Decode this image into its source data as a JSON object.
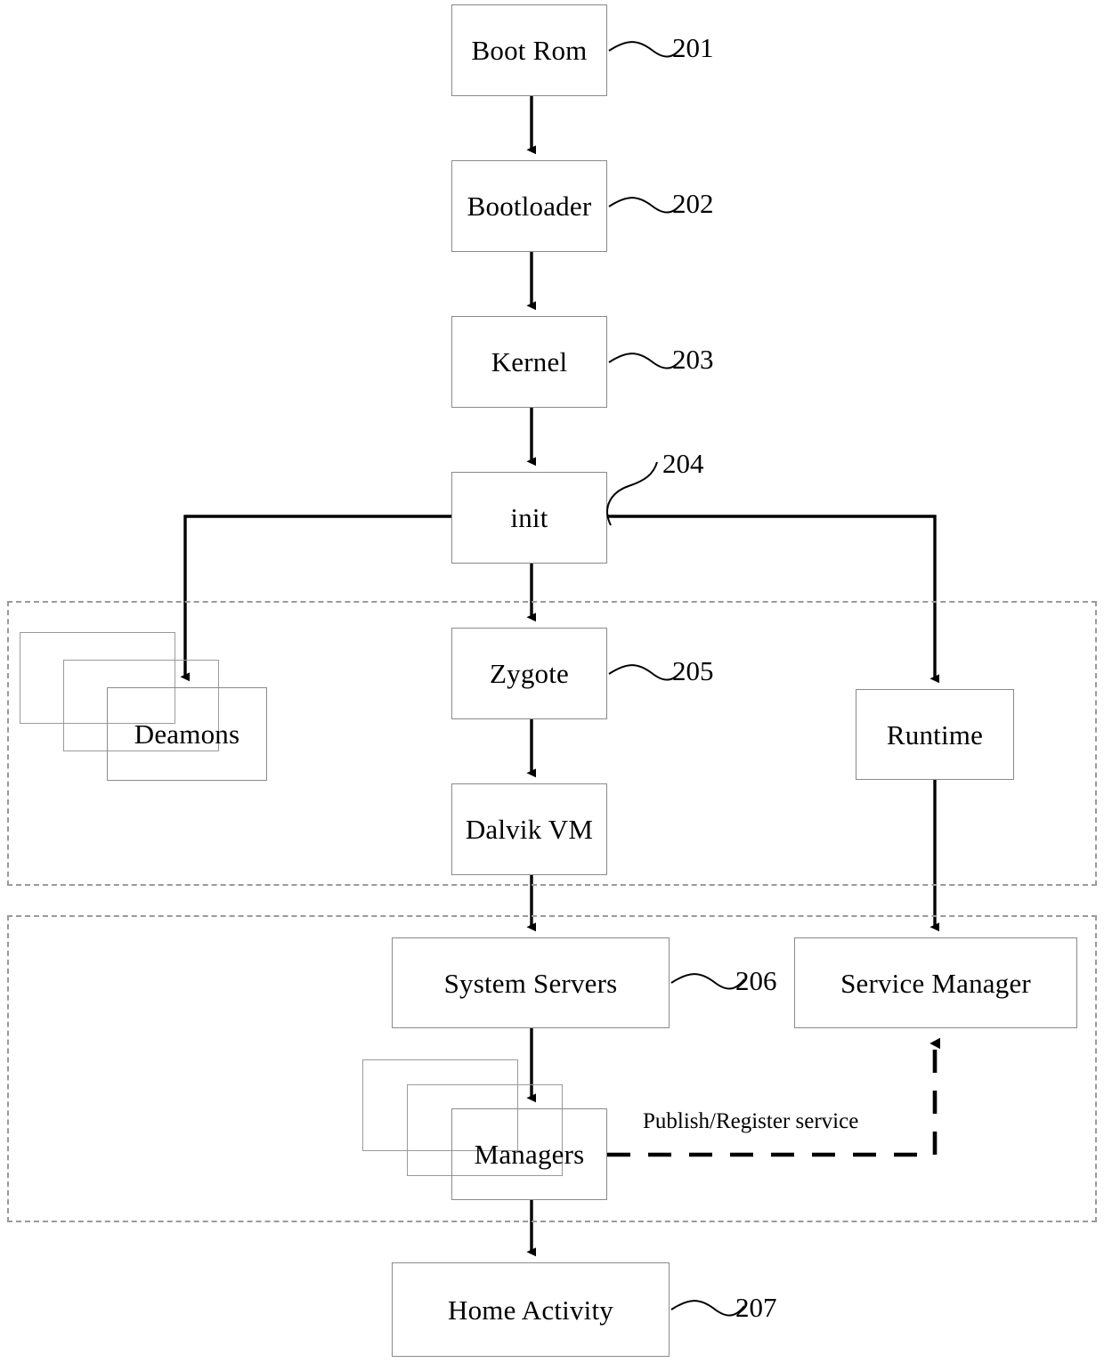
{
  "diagram": {
    "title": "Android boot sequence flow diagram",
    "stroke_color": "#000000",
    "box_border_color": "#8a8a8a",
    "dashed_group_color": "#9a9a9a",
    "background": "#ffffff"
  },
  "nodes": {
    "boot_rom": {
      "label": "Boot Rom"
    },
    "bootloader": {
      "label": "Bootloader"
    },
    "kernel": {
      "label": "Kernel"
    },
    "init": {
      "label": "init"
    },
    "zygote": {
      "label": "Zygote"
    },
    "dalvik_vm": {
      "label": "Dalvik VM"
    },
    "deamons": {
      "label": "Deamons"
    },
    "runtime": {
      "label": "Runtime"
    },
    "system_servers": {
      "label": "System Servers"
    },
    "service_manager": {
      "label": "Service Manager"
    },
    "managers": {
      "label": "Managers"
    },
    "home_activity": {
      "label": "Home Activity"
    }
  },
  "reference_numerals": {
    "boot_rom": "201",
    "bootloader": "202",
    "kernel": "203",
    "init": "204",
    "zygote": "205",
    "system_servers": "206",
    "home_activity": "207"
  },
  "edge_labels": {
    "publish_register": "Publish/Register service"
  }
}
